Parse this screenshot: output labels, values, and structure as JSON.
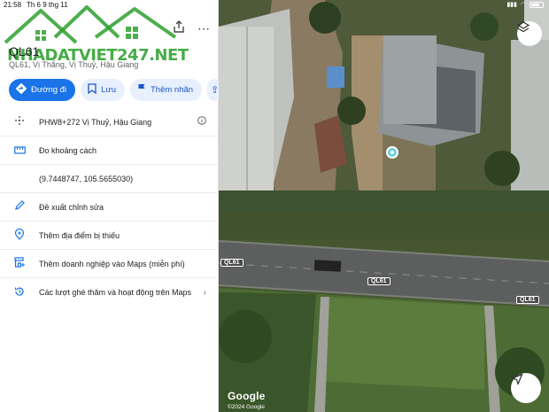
{
  "status_bar": {
    "time": "21:58",
    "date": "Th 6 9 thg 11"
  },
  "place": {
    "title": "QL61",
    "subtitle": "QL61, Vị Thắng, Vị Thuỷ, Hậu Giang"
  },
  "watermark": {
    "text": "NHADATVIET247.NET"
  },
  "actions": [
    {
      "label": "Đường đi",
      "icon": "directions-icon"
    },
    {
      "label": "Lưu",
      "icon": "bookmark-icon"
    },
    {
      "label": "Thêm nhãn",
      "icon": "flag-icon"
    }
  ],
  "list": [
    {
      "icon": "plus-code-icon",
      "text": "PHW8+272 Vị Thuỷ, Hậu Giang",
      "trailing": "info-icon"
    },
    {
      "icon": "ruler-icon",
      "text": "Đo khoảng cách"
    },
    {
      "icon": "",
      "text": "(9.7448747, 105.5655030)"
    },
    {
      "icon": "pencil-icon",
      "text": "Đề xuất chỉnh sửa"
    },
    {
      "icon": "add-location-icon",
      "text": "Thêm địa điểm bị thiếu"
    },
    {
      "icon": "add-business-icon",
      "text": "Thêm doanh nghiệp vào Maps (miễn phí)"
    },
    {
      "icon": "history-icon",
      "text": "Các lượt ghé thăm và hoạt động trên Maps",
      "trailing": "chevron-right-icon"
    }
  ],
  "map": {
    "road_labels": [
      "QL61",
      "QL61",
      "QL61"
    ],
    "logo": "Google",
    "copyright": "©2024 Google"
  }
}
